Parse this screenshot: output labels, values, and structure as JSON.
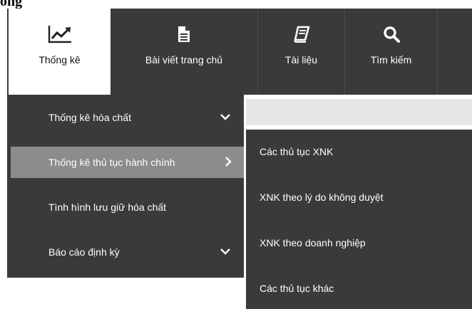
{
  "heading": "ong",
  "topnav": {
    "tabs": [
      {
        "label": "Thống kê",
        "icon": "line-chart-icon",
        "active": true
      },
      {
        "label": "Bài viết trang chủ",
        "icon": "document-icon",
        "active": false
      },
      {
        "label": "Tài liệu",
        "icon": "book-icon",
        "active": false
      },
      {
        "label": "Tìm kiếm",
        "icon": "search-icon",
        "active": false
      }
    ]
  },
  "menu": {
    "items": [
      {
        "label": "Thống kê hóa chất",
        "icon": "chevron-down-icon"
      },
      {
        "label": "Thống kê thủ tục hành chính",
        "icon": "chevron-right-icon",
        "highlighted": true
      },
      {
        "label": "Tình hình lưu giữ hóa chất"
      },
      {
        "label": "Báo cáo định kỳ",
        "icon": "chevron-down-icon"
      }
    ]
  },
  "submenu": {
    "items": [
      {
        "label": "Các thủ tục XNK"
      },
      {
        "label": "XNK theo lý do không duyệt"
      },
      {
        "label": "XNK theo doanh nghiệp"
      },
      {
        "label": "Các thủ tục khác"
      }
    ]
  },
  "colors": {
    "nav_bg": "#3a3a3a",
    "highlight_bg": "#8c8c8c",
    "submenu_header_bg": "#e6e6e6",
    "active_tab_bg": "#ffffff"
  }
}
